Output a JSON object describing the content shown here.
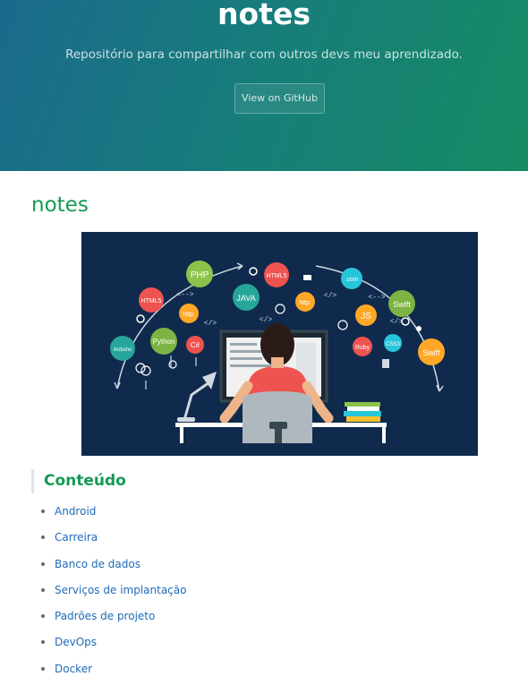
{
  "hero": {
    "title": "notes",
    "tagline": "Repositório para compartilhar com outros devs meu aprendizado.",
    "github_button": "View on GitHub"
  },
  "main": {
    "heading": "notes",
    "banner": {
      "bubbles": [
        "PHP",
        "HTML5",
        "JAVA",
        "HTML5",
        "http:",
        ".com",
        "Swift",
        "http:",
        "JS",
        "Arduino",
        "Python",
        "C#",
        "Ruby",
        "CSS3",
        "Swift"
      ],
      "code_tags": [
        "</>",
        "</>",
        "<-->",
        "</>",
        "<-->",
        "</>"
      ]
    },
    "toc": {
      "heading": "Conteúdo",
      "items": [
        "Android",
        "Carreira",
        "Banco de dados",
        "Serviços de implantação",
        "Padrões de projeto",
        "DevOps",
        "Docker"
      ]
    }
  },
  "colors": {
    "accent": "#159957",
    "link": "#1e6bb8",
    "hero_start": "#1a6a8c",
    "hero_end": "#168a63",
    "banner_bg": "#0f2a4c"
  }
}
